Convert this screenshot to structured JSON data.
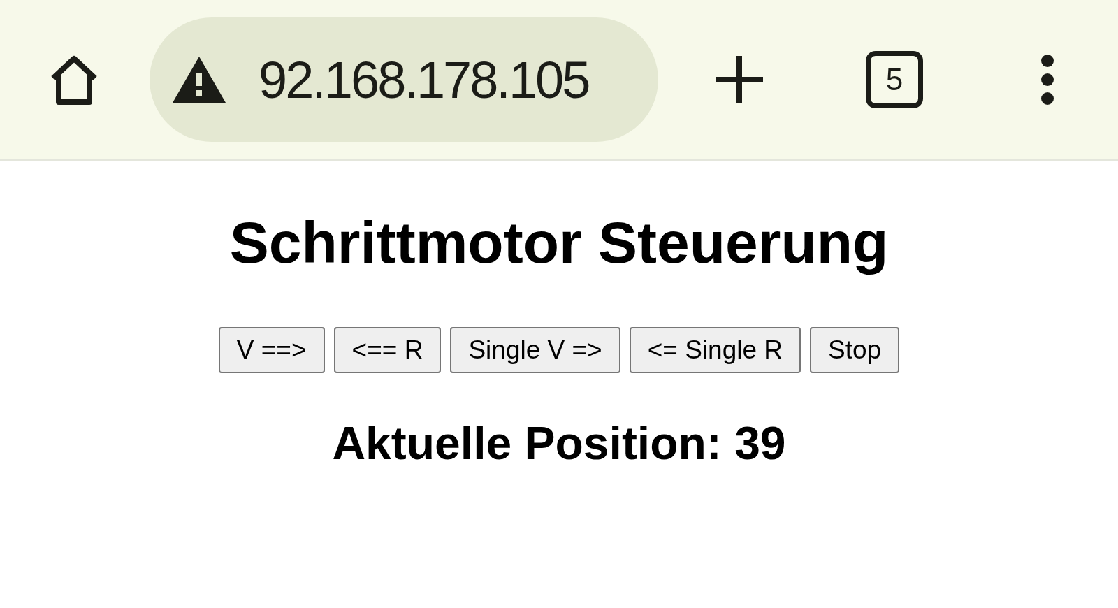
{
  "browser": {
    "address": "92.168.178.105",
    "tab_count": "5"
  },
  "page": {
    "title": "Schrittmotor Steuerung",
    "buttons": [
      "V ==>",
      "<== R",
      "Single V =>",
      "<= Single R",
      "Stop"
    ],
    "position": "Aktuelle Position: 39"
  }
}
